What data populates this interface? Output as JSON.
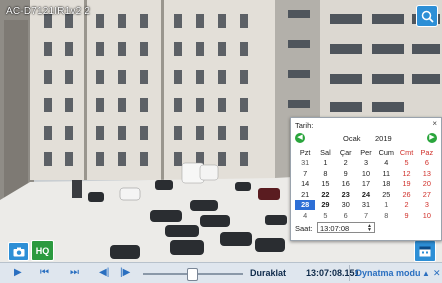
{
  "camera": {
    "name": "AC-D7121IR1v2 2"
  },
  "buttons": {
    "hq_label": "HQ"
  },
  "picker": {
    "title": "Tarih:",
    "close": "×",
    "month": "Ocak",
    "year": "2019",
    "weekdays": [
      "Pzt",
      "Sal",
      "Çar",
      "Per",
      "Cum",
      "Cmt",
      "Paz"
    ],
    "weeks": [
      [
        "31",
        "1",
        "2",
        "3",
        "4",
        "5",
        "6"
      ],
      [
        "7",
        "8",
        "9",
        "10",
        "11",
        "12",
        "13"
      ],
      [
        "14",
        "15",
        "16",
        "17",
        "18",
        "19",
        "20"
      ],
      [
        "21",
        "22",
        "23",
        "24",
        "25",
        "26",
        "27"
      ],
      [
        "28",
        "29",
        "30",
        "31",
        "1",
        "2",
        "3"
      ],
      [
        "4",
        "5",
        "6",
        "7",
        "8",
        "9",
        "10"
      ]
    ],
    "selected_day": "28",
    "time_label": "Saat:",
    "time_value": "13:07:08"
  },
  "controls": {
    "status": "Duraklat",
    "timestamp": "13:07:08.151",
    "mode": "Oynatma modu"
  },
  "colors": {
    "accent": "#2d8fd6",
    "hq": "#2c9a3f",
    "weekend": "#d0302a",
    "selected": "#2d6fd6"
  }
}
